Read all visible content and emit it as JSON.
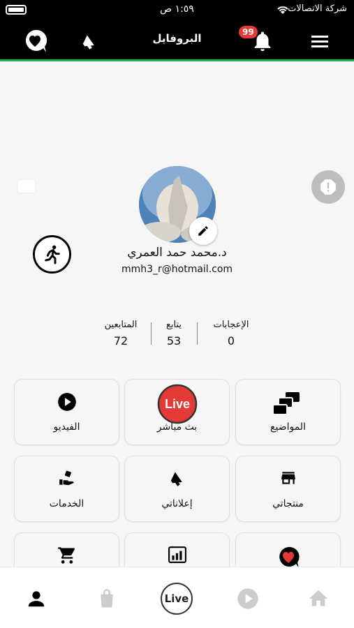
{
  "status_bar": {
    "time": "١:٥٩ ص",
    "carrier": "شركة الاتصالات"
  },
  "header": {
    "title": "البروفايل",
    "notification_count": "99"
  },
  "profile": {
    "name": "د.محمد حمد العمري",
    "email": "mmh3_r@hotmail.com"
  },
  "stats": [
    {
      "label": "الإعجابات",
      "value": "0"
    },
    {
      "label": "يتابع",
      "value": "53"
    },
    {
      "label": "المتابعين",
      "value": "72"
    }
  ],
  "tiles": [
    {
      "label": "المواضيع",
      "icon": "topics-blocks-icon"
    },
    {
      "label": "بث مباشر",
      "icon": "live-broadcast-icon",
      "badge": "Live"
    },
    {
      "label": "الفيديو",
      "icon": "play-circle-icon"
    },
    {
      "label": "منتجاتي",
      "icon": "store-icon"
    },
    {
      "label": "إعلاناتي",
      "icon": "megaphone-icon"
    },
    {
      "label": "الخدمات",
      "icon": "service-hand-icon"
    },
    {
      "label": "",
      "icon": "heart-chat-icon"
    },
    {
      "label": "",
      "icon": "stats-screen-icon"
    },
    {
      "label": "",
      "icon": "cart-icon"
    }
  ],
  "tabbar": {
    "live_label": "Live"
  },
  "colors": {
    "header_bg": "#000000",
    "accent_green": "#1fb24a",
    "live_red": "#e53935",
    "inactive_tab": "#cccccc"
  }
}
